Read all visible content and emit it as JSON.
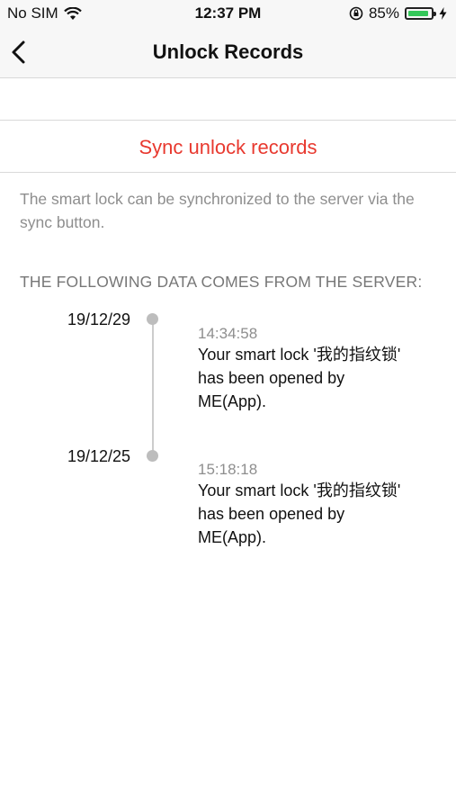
{
  "status_bar": {
    "carrier": "No SIM",
    "time": "12:37 PM",
    "battery_percent": "85%",
    "battery_level": 0.85,
    "accent_color": "#34c759"
  },
  "nav": {
    "title": "Unlock Records",
    "back_icon": "chevron-left-icon"
  },
  "sync": {
    "label": "Sync unlock records",
    "color": "#e8392f"
  },
  "description": "The smart lock can be synchronized to the server via the sync button.",
  "section_header": "THE FOLLOWING DATA COMES FROM THE SERVER:",
  "records": [
    {
      "date": "19/12/29",
      "time": "14:34:58",
      "message": "Your smart lock '我的指纹锁' has been opened by ME(App)."
    },
    {
      "date": "19/12/25",
      "time": "15:18:18",
      "message": "Your smart lock '我的指纹锁' has been opened by ME(App)."
    }
  ]
}
